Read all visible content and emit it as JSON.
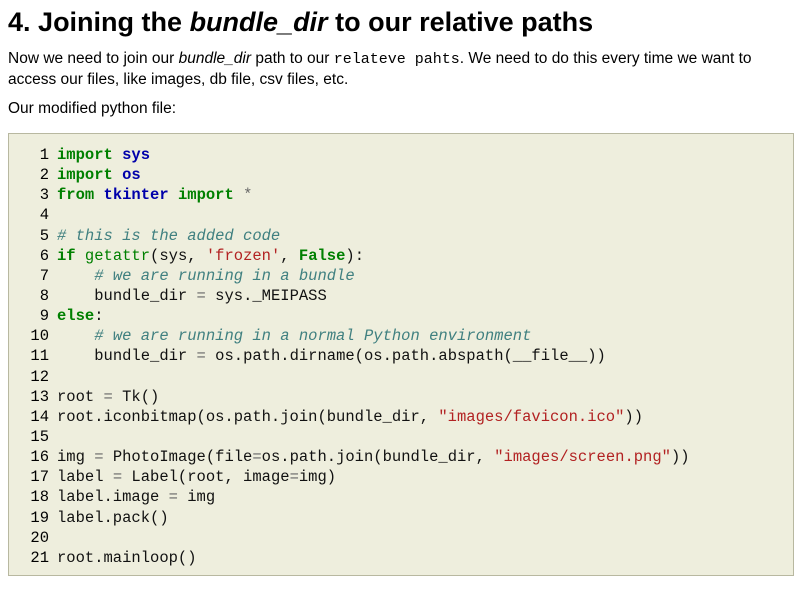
{
  "heading": {
    "number": "4.",
    "pre": "Joining the",
    "em": "bundle_dir",
    "post": "to our relative paths"
  },
  "intro": {
    "t1": "Now we need to join our ",
    "em": "bundle_dir",
    "t2": " path to our ",
    "code": "relateve pahts",
    "t3": ". We need to do this every time we want to access our files, like images, db file, csv files, etc."
  },
  "modified_label": "Our modified python file:",
  "code": {
    "line_numbers": [
      "1",
      "2",
      "3",
      "4",
      "5",
      "6",
      "7",
      "8",
      "9",
      "10",
      "11",
      "12",
      "13",
      "14",
      "15",
      "16",
      "17",
      "18",
      "19",
      "20",
      "21"
    ],
    "l1": [
      "import",
      "sys"
    ],
    "l2": [
      "import",
      "os"
    ],
    "l3": [
      "from",
      "tkinter",
      "import",
      "*"
    ],
    "l5": "# this is the added code",
    "l6": [
      "if",
      "getattr",
      "(sys, ",
      "'frozen'",
      ", ",
      "False",
      "):"
    ],
    "l7": "# we are running in a bundle",
    "l8": [
      "bundle_dir ",
      "=",
      " sys._MEIPASS"
    ],
    "l9": [
      "else",
      ":"
    ],
    "l10": "# we are running in a normal Python environment",
    "l11": [
      "bundle_dir ",
      "=",
      " os.path.dirname(os.path.abspath(__file__))"
    ],
    "l13": [
      "root ",
      "=",
      " Tk()"
    ],
    "l14": [
      "root.iconbitmap(os.path.join(bundle_dir, ",
      "\"images/favicon.ico\"",
      "))"
    ],
    "l16": [
      "img ",
      "=",
      " PhotoImage(file",
      "=",
      "os.path.join(bundle_dir, ",
      "\"images/screen.png\"",
      "))"
    ],
    "l17": [
      "label ",
      "=",
      " Label(root, image",
      "=",
      "img)"
    ],
    "l18": [
      "label.image ",
      "=",
      " img"
    ],
    "l19": "label.pack()",
    "l21": "root.mainloop()"
  }
}
